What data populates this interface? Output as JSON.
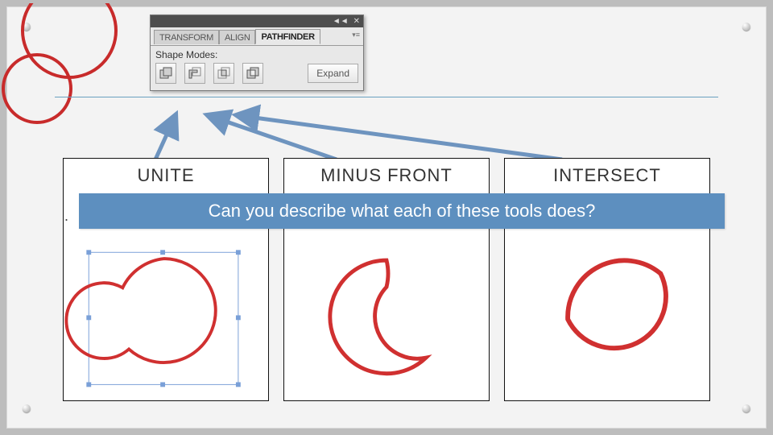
{
  "panel": {
    "tabs": {
      "transform": "TRANSFORM",
      "align": "ALIGN",
      "pathfinder": "PATHFINDER"
    },
    "section_label": "Shape Modes:",
    "expand": "Expand"
  },
  "tools": {
    "unite": "UNITE",
    "minus_front": "MINUS FRONT",
    "intersect": "INTERSECT"
  },
  "question": "Can you describe what each of these tools does?"
}
